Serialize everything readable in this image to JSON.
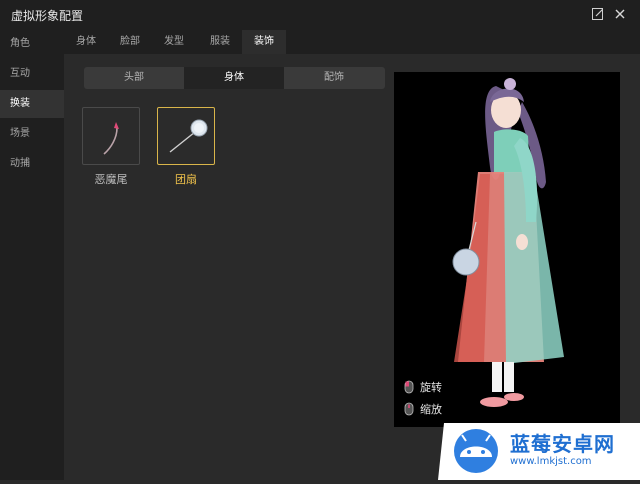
{
  "window": {
    "title": "虚拟形象配置"
  },
  "sidebar": {
    "items": [
      {
        "label": "角色"
      },
      {
        "label": "互动"
      },
      {
        "label": "换装"
      },
      {
        "label": "场景"
      },
      {
        "label": "动捕"
      }
    ],
    "active_index": 2
  },
  "tabs": [
    {
      "label": "身体"
    },
    {
      "label": "脸部"
    },
    {
      "label": "发型"
    },
    {
      "label": "服装"
    },
    {
      "label": "装饰"
    }
  ],
  "active_tab": 4,
  "subtabs": [
    {
      "label": "头部"
    },
    {
      "label": "身体"
    },
    {
      "label": "配饰"
    }
  ],
  "active_subtab": 1,
  "items": [
    {
      "label": "恶魔尾",
      "icon": "devil-tail-icon",
      "selected": false
    },
    {
      "label": "团扇",
      "icon": "round-fan-icon",
      "selected": true
    }
  ],
  "controls": [
    {
      "label": "旋转",
      "icon": "mouse-left-icon"
    },
    {
      "label": "缩放",
      "icon": "mouse-scroll-icon"
    }
  ],
  "watermark": {
    "name": "蓝莓安卓网",
    "url": "www.lmkjst.com"
  },
  "colors": {
    "accent": "#d9b54a",
    "accent_text": "#f0c24b",
    "watermark": "#1f6fd1"
  }
}
